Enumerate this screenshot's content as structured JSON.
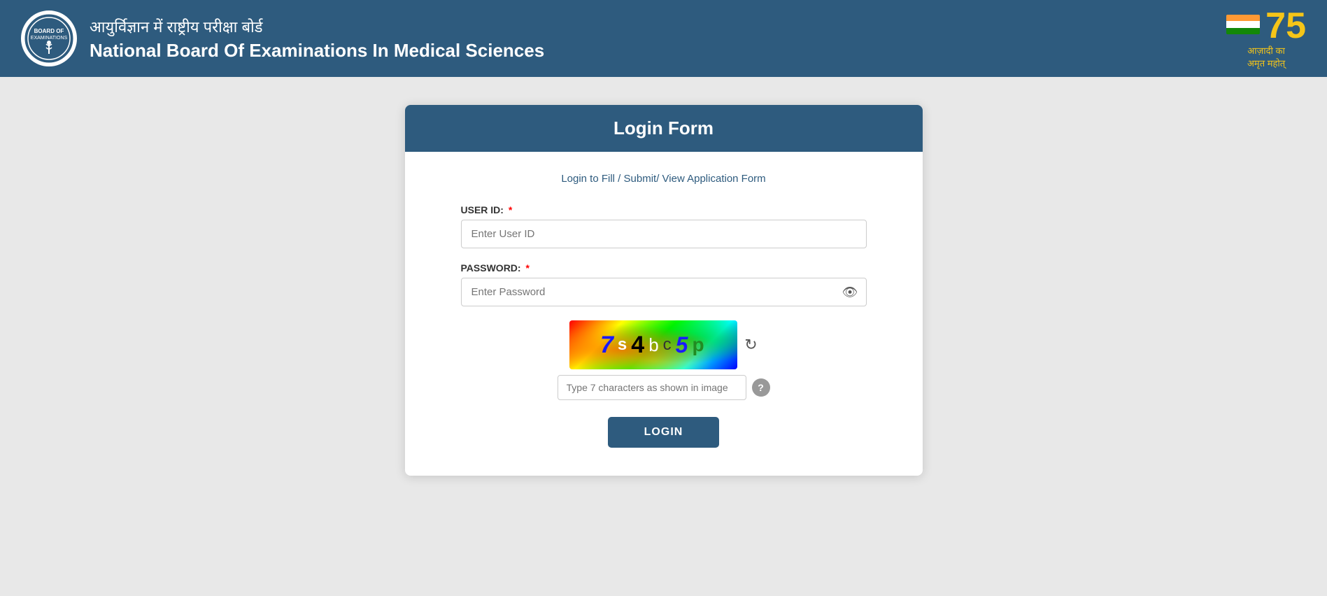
{
  "header": {
    "hindi_title": "आयुर्विज्ञान में राष्ट्रीय परीक्षा बोर्ड",
    "english_title": "National Board Of Examinations In Medical Sciences",
    "azadi_number": "75",
    "azadi_line1": "आज़ादी का",
    "azadi_line2": "अमृत महोत्"
  },
  "login_form": {
    "title": "Login Form",
    "subtitle": "Login to Fill / Submit/ View Application Form",
    "user_id_label": "USER ID:",
    "user_id_placeholder": "Enter User ID",
    "password_label": "PASSWORD:",
    "password_placeholder": "Enter Password",
    "captcha_text": "7s4bc5p",
    "captcha_placeholder": "Type 7 characters as shown in image",
    "captcha_tooltip": "?",
    "captcha_refresh_icon": "↻",
    "login_button": "LOGIN",
    "required_marker": "*"
  }
}
